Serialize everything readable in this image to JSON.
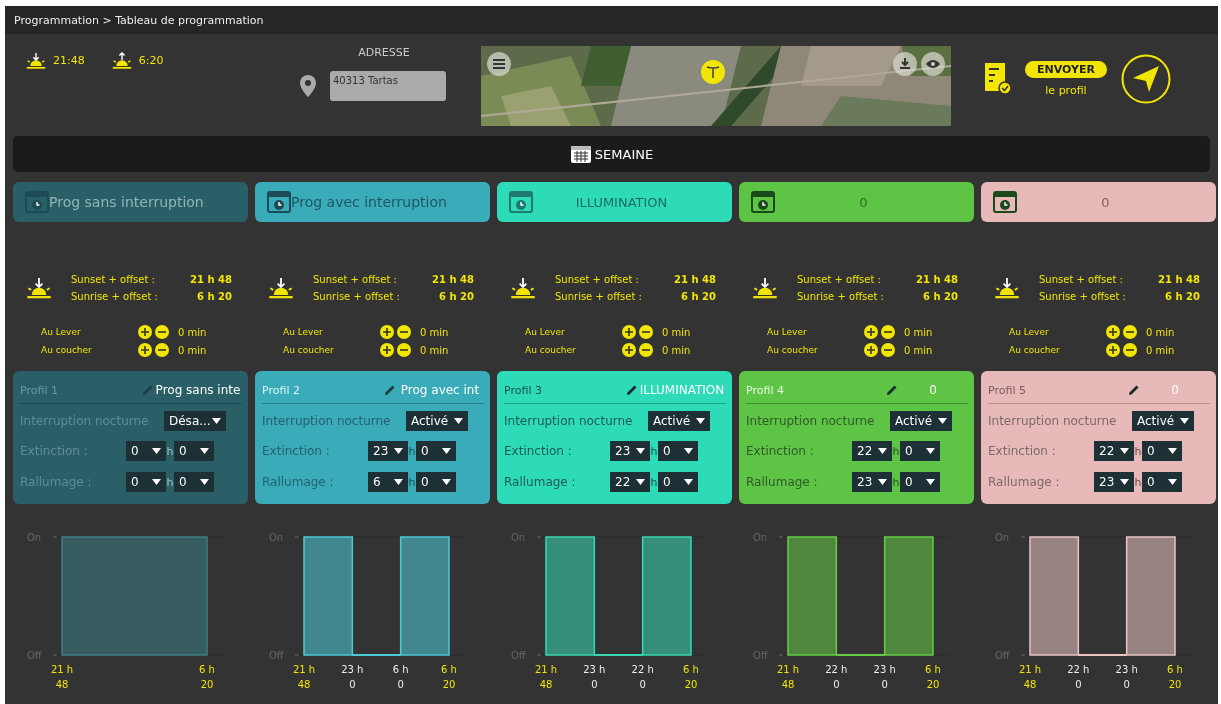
{
  "breadcrumb": "Programmation > Tableau de programmation",
  "sun_times": [
    {
      "kind": "sunset",
      "time": "21:48"
    },
    {
      "kind": "sunrise",
      "time": "6:20"
    }
  ],
  "address": {
    "label": "ADRESSE",
    "value": "40313 Tartas"
  },
  "send": {
    "button": "ENVOYER",
    "caption": "le profil"
  },
  "week_bar": {
    "label": "SEMAINE"
  },
  "profiles": [
    {
      "color": "#2b5f67",
      "tab": "Prog sans interruption",
      "sunset_label": "Sunset + offset :",
      "sunset": "21 h 48",
      "sunrise_label": "Sunrise + offset :",
      "sunrise": "6 h 20",
      "offsets": [
        {
          "label": "Au Lever",
          "value": "0 min"
        },
        {
          "label": "Au coucher",
          "value": "0 min"
        }
      ],
      "card": {
        "name": "Profil 1",
        "program": "Prog sans inte",
        "interruption_label": "Interruption nocturne",
        "interruption": "Désa...",
        "rows": [
          {
            "label": "Extinction :",
            "hours": "0",
            "unit": "h",
            "minutes": "0"
          },
          {
            "label": "Rallumage :",
            "hours": "0",
            "unit": "h",
            "minutes": "0"
          }
        ]
      },
      "schedule": {
        "color": "#3c7f87",
        "on_label": "On",
        "off_label": "Off",
        "times": [
          "21 h 48",
          "6 h 20"
        ],
        "segments": [
          {
            "on": true
          }
        ]
      }
    },
    {
      "color": "#3aacb9",
      "tab": "Prog avec interruption",
      "sunset_label": "Sunset + offset :",
      "sunset": "21 h 48",
      "sunrise_label": "Sunrise + offset :",
      "sunrise": "6 h 20",
      "offsets": [
        {
          "label": "Au Lever",
          "value": "0 min"
        },
        {
          "label": "Au coucher",
          "value": "0 min"
        }
      ],
      "card": {
        "name": "Profil 2",
        "program": "Prog avec int",
        "interruption_label": "Interruption nocturne",
        "interruption": "Activé",
        "rows": [
          {
            "label": "Extinction :",
            "hours": "23",
            "unit": "h",
            "minutes": "0"
          },
          {
            "label": "Rallumage :",
            "hours": "6",
            "unit": "h",
            "minutes": "0"
          }
        ]
      },
      "schedule": {
        "color": "#4ccbd6",
        "on_label": "On",
        "off_label": "Off",
        "times": [
          "21 h 48",
          "23 h 0",
          "6 h 0",
          "6 h 20"
        ],
        "segments": [
          {
            "on": true
          },
          {
            "on": false
          },
          {
            "on": true
          }
        ]
      }
    },
    {
      "color": "#2edbb9",
      "tab": "ILLUMINATION",
      "sunset_label": "Sunset + offset :",
      "sunset": "21 h 48",
      "sunrise_label": "Sunrise + offset :",
      "sunrise": "6 h 20",
      "offsets": [
        {
          "label": "Au Lever",
          "value": "0 min"
        },
        {
          "label": "Au coucher",
          "value": "0 min"
        }
      ],
      "card": {
        "name": "Profil 3",
        "program": "ILLUMINATION",
        "interruption_label": "Interruption nocturne",
        "interruption": "Activé",
        "rows": [
          {
            "label": "Extinction :",
            "hours": "23",
            "unit": "h",
            "minutes": "0"
          },
          {
            "label": "Rallumage :",
            "hours": "22",
            "unit": "h",
            "minutes": "0"
          }
        ]
      },
      "schedule": {
        "color": "#36d9b1",
        "on_label": "On",
        "off_label": "Off",
        "times": [
          "21 h 48",
          "23 h 0",
          "22 h 0",
          "6 h 20"
        ],
        "segments": [
          {
            "on": true
          },
          {
            "on": false
          },
          {
            "on": true
          }
        ]
      }
    },
    {
      "color": "#5ec446",
      "tab": "0",
      "sunset_label": "Sunset + offset :",
      "sunset": "21 h 48",
      "sunrise_label": "Sunrise + offset :",
      "sunrise": "6 h 20",
      "offsets": [
        {
          "label": "Au Lever",
          "value": "0 min"
        },
        {
          "label": "Au coucher",
          "value": "0 min"
        }
      ],
      "card": {
        "name": "Profil 4",
        "program": "0",
        "interruption_label": "Interruption nocturne",
        "interruption": "Activé",
        "rows": [
          {
            "label": "Extinction :",
            "hours": "22",
            "unit": "h",
            "minutes": "0"
          },
          {
            "label": "Rallumage :",
            "hours": "23",
            "unit": "h",
            "minutes": "0"
          }
        ]
      },
      "schedule": {
        "color": "#66cc44",
        "on_label": "On",
        "off_label": "Off",
        "times": [
          "21 h 48",
          "22 h 0",
          "23 h 0",
          "6 h 20"
        ],
        "segments": [
          {
            "on": true
          },
          {
            "on": false
          },
          {
            "on": true
          }
        ]
      }
    },
    {
      "color": "#e8b9b9",
      "tab": "0",
      "sunset_label": "Sunset + offset :",
      "sunset": "21 h 48",
      "sunrise_label": "Sunrise + offset :",
      "sunrise": "6 h 20",
      "offsets": [
        {
          "label": "Au Lever",
          "value": "0 min"
        },
        {
          "label": "Au coucher",
          "value": "0 min"
        }
      ],
      "card": {
        "name": "Profil 5",
        "program": "0",
        "interruption_label": "Interruption nocturne",
        "interruption": "Activé",
        "rows": [
          {
            "label": "Extinction :",
            "hours": "22",
            "unit": "h",
            "minutes": "0"
          },
          {
            "label": "Rallumage :",
            "hours": "23",
            "unit": "h",
            "minutes": "0"
          }
        ]
      },
      "schedule": {
        "color": "#eac3c3",
        "on_label": "On",
        "off_label": "Off",
        "times": [
          "21 h 48",
          "22 h 0",
          "23 h 0",
          "6 h 20"
        ],
        "segments": [
          {
            "on": true
          },
          {
            "on": false
          },
          {
            "on": true
          }
        ]
      }
    }
  ]
}
